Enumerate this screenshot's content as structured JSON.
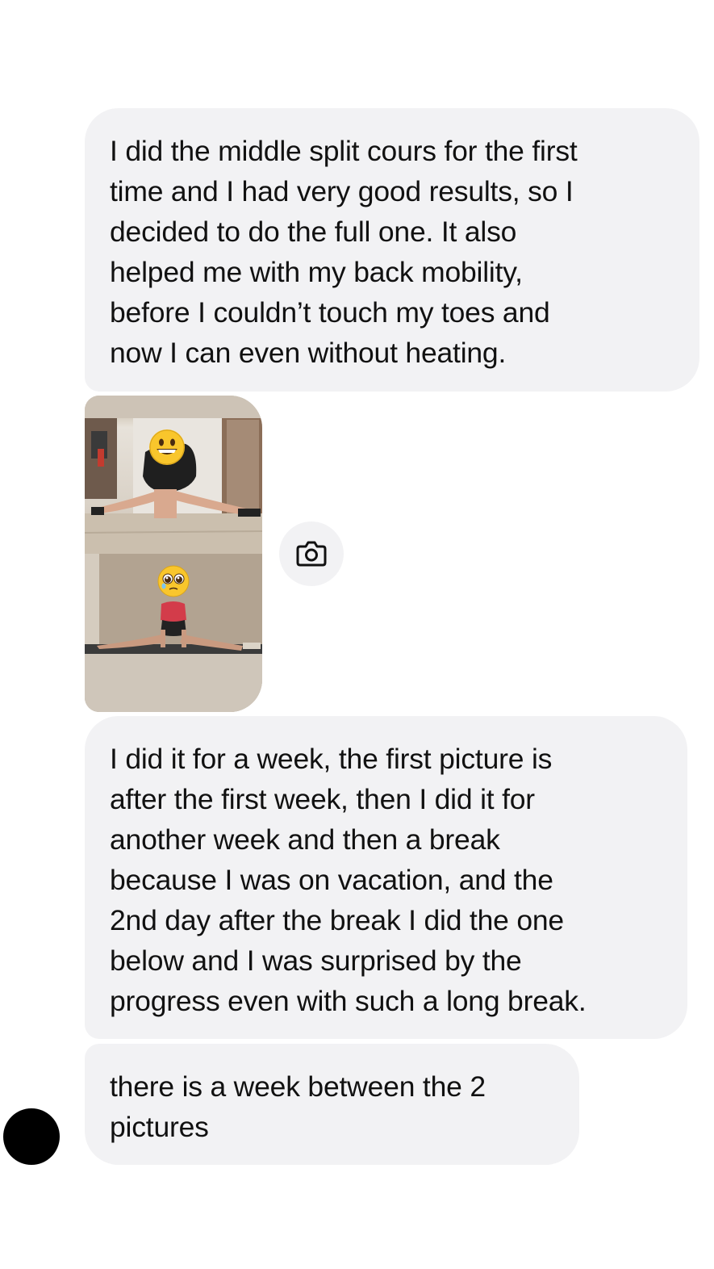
{
  "messages": {
    "msg1": {
      "lines": [
        "I did the middle split cours for the first",
        "time and I had very good results, so I",
        "decided to do the full one. It also",
        "helped me with my back mobility,",
        "before I couldn’t touch my toes and",
        "now I can even without heating."
      ]
    },
    "msg3": {
      "lines": [
        "I did it for a week, the first picture is",
        "after the first week, then I did it for",
        "another week and then a break",
        "because I was on vacation, and the",
        "2nd day after the break I did the one",
        "below and I was surprised by the",
        "progress even with such a long break."
      ]
    },
    "msg4": {
      "lines": [
        "there is a week between the 2",
        "pictures"
      ]
    }
  },
  "photos": [
    {
      "icon": "grinning-face-emoji",
      "emoji": "😀"
    },
    {
      "icon": "pleading-face-emoji",
      "emoji": "🥹"
    }
  ],
  "camera_button": {
    "icon": "camera-icon"
  },
  "colors": {
    "bubble_background": "#f2f2f4",
    "text": "#111111",
    "page_background": "#ffffff",
    "avatar": "#000000"
  }
}
